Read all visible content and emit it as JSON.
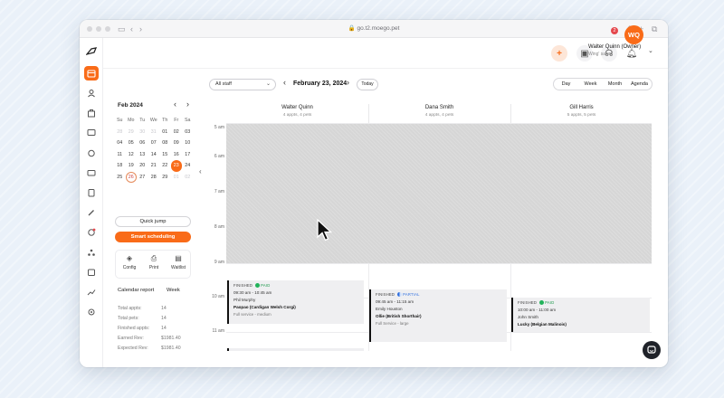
{
  "browser": {
    "url": "go.t2.moego.pet"
  },
  "header": {
    "user_name": "Walter Quinn (Owner)",
    "business": "Wing' salon",
    "initials": "WQ",
    "notification_count": "2"
  },
  "mini_calendar": {
    "month_label": "Feb 2024",
    "weekdays": [
      "Su",
      "Mo",
      "Tu",
      "We",
      "Th",
      "Fr",
      "Sa"
    ],
    "weeks": [
      [
        "28",
        "29",
        "30",
        "31",
        "01",
        "02",
        "03"
      ],
      [
        "04",
        "05",
        "06",
        "07",
        "08",
        "09",
        "10"
      ],
      [
        "11",
        "12",
        "13",
        "14",
        "15",
        "16",
        "17"
      ],
      [
        "18",
        "19",
        "20",
        "21",
        "22",
        "23",
        "24"
      ],
      [
        "25",
        "26",
        "27",
        "28",
        "29",
        "01",
        "02"
      ]
    ],
    "selected_day": "23",
    "today_day": "26"
  },
  "sidebar": {
    "quick_jump": "Quick jump",
    "smart_scheduling": "Smart scheduling",
    "tools": [
      "Config",
      "Print",
      "Waitlist"
    ],
    "report_title": "Calendar report",
    "report_period": "Week",
    "stats": [
      {
        "label": "Total appts:",
        "value": "14"
      },
      {
        "label": "Total pets:",
        "value": "14"
      },
      {
        "label": "Finished appts:",
        "value": "14"
      },
      {
        "label": "Earned Rev:",
        "value": "$1981.40"
      },
      {
        "label": "Expected Rev:",
        "value": "$1981.40"
      }
    ]
  },
  "toolbar": {
    "staff_filter": "All staff",
    "date": "February 23, 2024",
    "today": "Today",
    "views": [
      "Day",
      "Week",
      "Month",
      "Agenda"
    ]
  },
  "staff_columns": [
    {
      "name": "Walter Quinn",
      "summary": "4 appts, 4 pets"
    },
    {
      "name": "Dana Smith",
      "summary": "4 appts, 4 pets"
    },
    {
      "name": "Gill Harris",
      "summary": "5 appts, 5 pets"
    }
  ],
  "time_labels": [
    "5 am",
    "6 am",
    "7 am",
    "8 am",
    "9 am",
    "10 am",
    "11 am"
  ],
  "appointments": [
    {
      "status": "FINISHED",
      "payment": "PAID",
      "time": "09:30 am - 10:45 am",
      "client": "Phil Murphy",
      "pet": "Paopao (Cardigan Welsh Corgi)",
      "service": "Full service - medium"
    },
    {
      "status": "FINISHED",
      "payment": "PARTIAL",
      "time": "09:45 am - 11:15 am",
      "client": "Emily Houston",
      "pet": "Ollie (British Shorthair)",
      "service": "Full Service - large"
    },
    {
      "status": "FINISHED",
      "payment": "PAID",
      "time": "10:00 am - 11:00 am",
      "client": "John Smith",
      "pet": "Lucky (Belgian Malinois)",
      "service": ""
    }
  ],
  "colors": {
    "accent": "#f96b18",
    "paid": "#22b35a",
    "partial": "#2f6fe0",
    "blocked": "#d6d6d6"
  }
}
